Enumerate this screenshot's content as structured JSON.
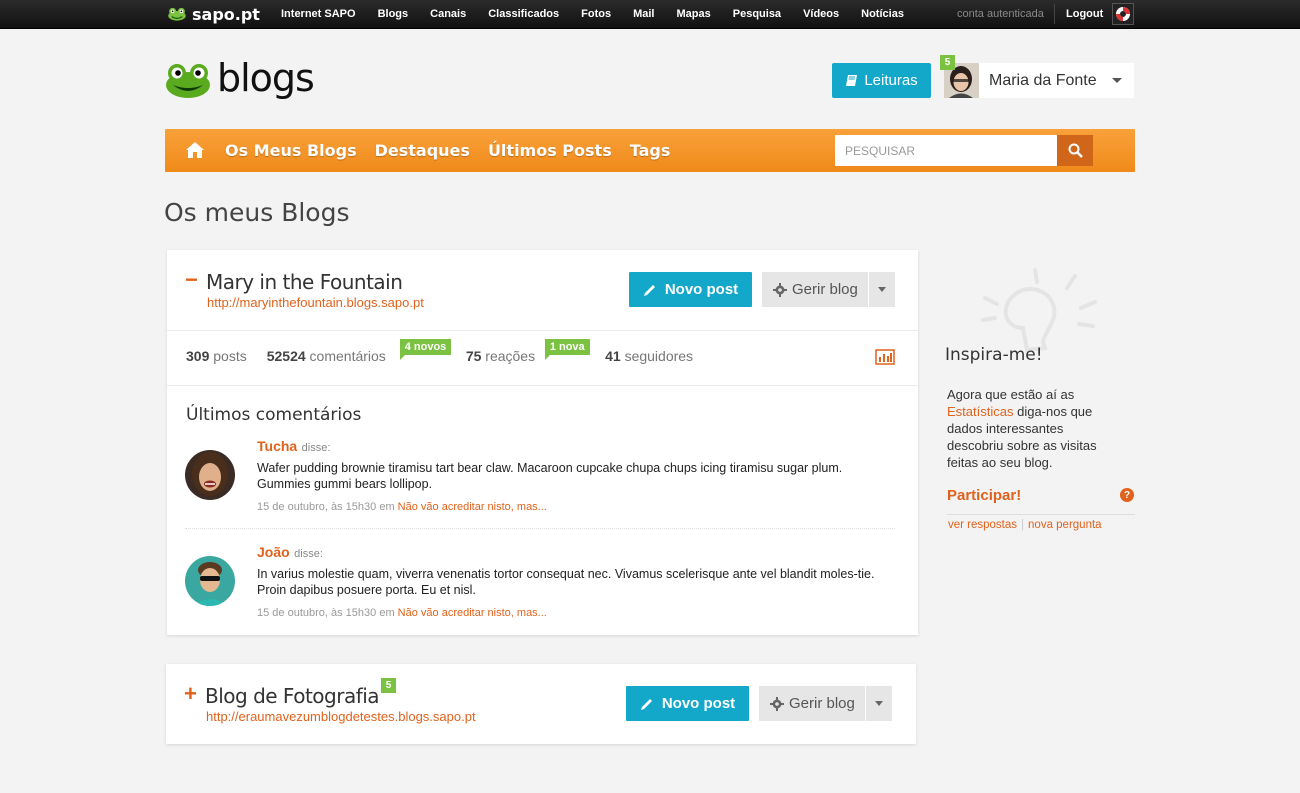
{
  "topbar": {
    "brand": "sapo.pt",
    "links": [
      "Internet SAPO",
      "Blogs",
      "Canais",
      "Classificados",
      "Fotos",
      "Mail",
      "Mapas",
      "Pesquisa",
      "Vídeos",
      "Notícias"
    ],
    "auth_status": "conta autenticada",
    "logout": "Logout"
  },
  "header": {
    "logo_text": "blogs",
    "leituras_label": "Leituras",
    "user": {
      "name": "Maria da Fonte",
      "badge": "5"
    }
  },
  "nav": {
    "items": [
      "Os Meus Blogs",
      "Destaques",
      "Últimos Posts",
      "Tags"
    ],
    "search_placeholder": "PESQUISAR"
  },
  "page_title": "Os meus Blogs",
  "blogs": [
    {
      "toggle": "−",
      "name": "Mary in the Fountain",
      "url": "http://maryinthefountain.blogs.sapo.pt",
      "novo_post": "Novo post",
      "gerir_blog": "Gerir blog",
      "stats": {
        "posts_count": "309",
        "posts_label": "posts",
        "comments_count": "52524",
        "comments_label": "comentários",
        "comments_tag": "4 novos",
        "reactions_count": "75",
        "reactions_label": "reações",
        "reactions_tag": "1 nova",
        "followers_count": "41",
        "followers_label": "seguidores"
      },
      "comments_title": "Últimos comentários",
      "comments": [
        {
          "author": "Tucha",
          "said": "disse:",
          "text": "Wafer pudding brownie tiramisu tart bear claw. Macaroon cupcake chupa chups icing tiramisu sugar plum. Gummies gummi bears lollipop.",
          "date": "15 de outubro, às 15h30 em",
          "post": "Não vão acreditar nisto, mas..."
        },
        {
          "author": "João",
          "said": "disse:",
          "text": "In varius molestie quam, viverra venenatis tortor consequat nec. Vivamus scelerisque ante vel blandit moles-tie. Proin dapibus posuere porta. Eu et nisl.",
          "date": "15 de outubro, às 15h30 em",
          "post": "Não vão acreditar nisto, mas..."
        }
      ]
    },
    {
      "toggle": "+",
      "name": "Blog de Fotografia",
      "badge": "5",
      "url": "http://eraumavezumblogdetestes.blogs.sapo.pt",
      "novo_post": "Novo post",
      "gerir_blog": "Gerir blog"
    }
  ],
  "sidebar": {
    "title": "Inspira-me!",
    "text_before": "Agora que estão aí as",
    "link": "Estatísticas",
    "text_after": "diga-nos que dados interessantes descobriu sobre as visitas feitas ao seu blog.",
    "participar": "Participar!",
    "help": "?",
    "ver_respostas": "ver respostas",
    "nova_pergunta": "nova pergunta"
  },
  "colors": {
    "accent_orange": "#f08a1a",
    "link_orange": "#e0621c",
    "cyan": "#13a8c9",
    "green_tag": "#7cc242"
  }
}
